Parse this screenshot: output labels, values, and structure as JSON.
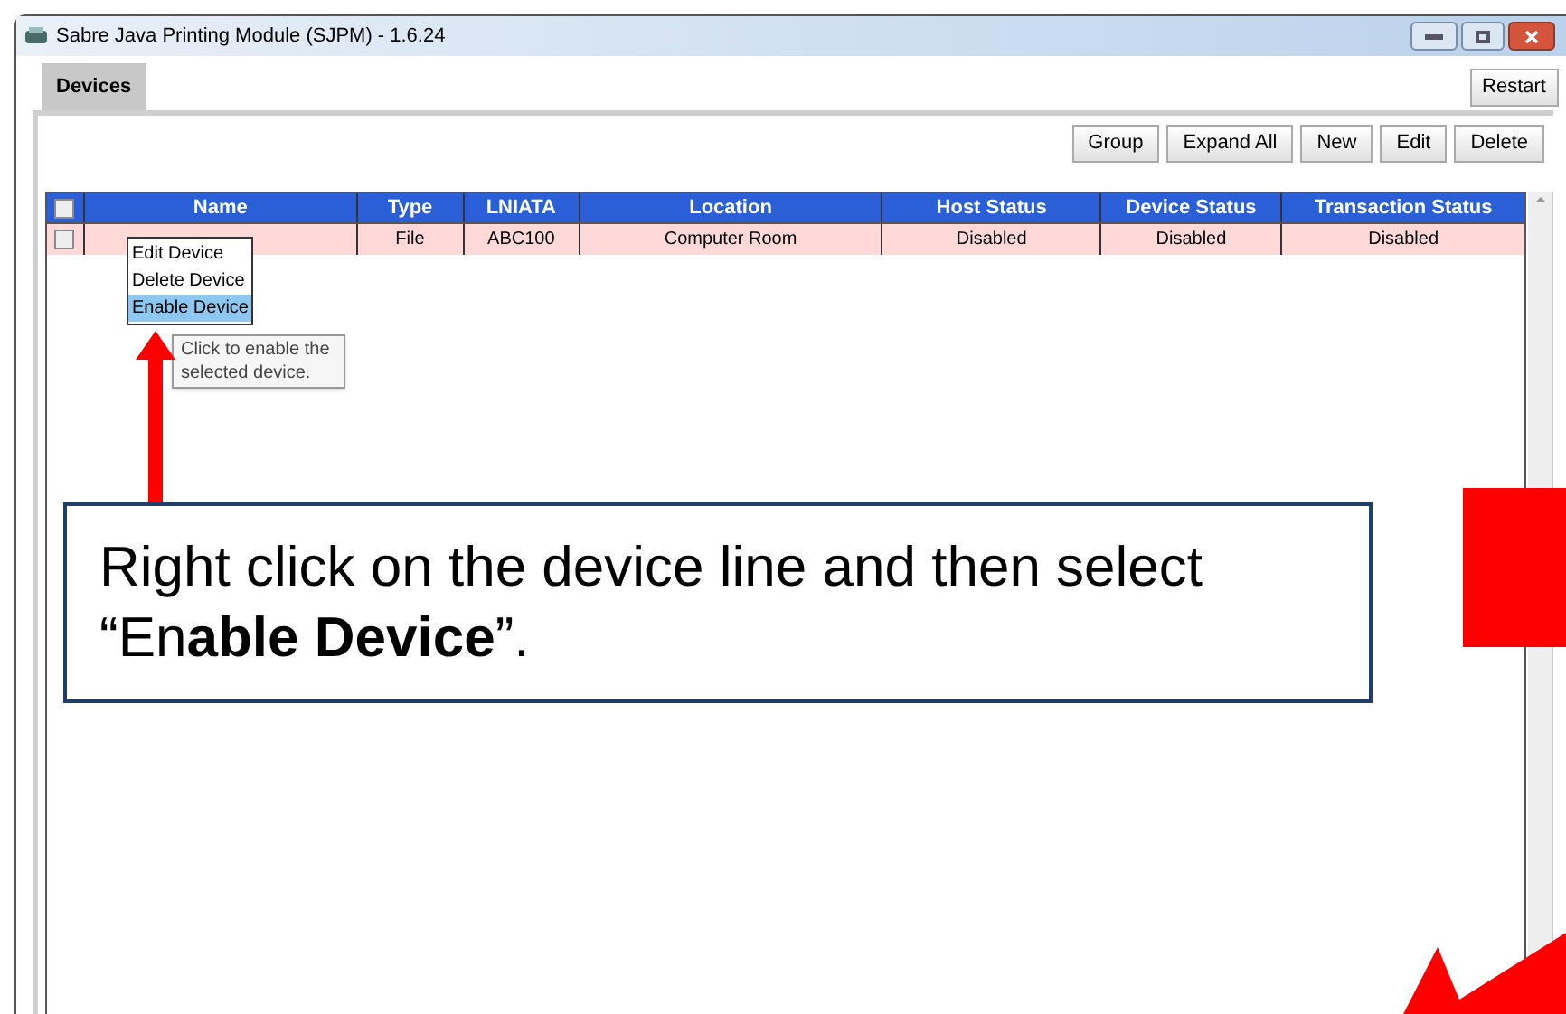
{
  "window": {
    "title": "Sabre Java Printing Module (SJPM) - 1.6.24"
  },
  "tabs": [
    {
      "label": "Devices",
      "selected": true
    }
  ],
  "restart_button": "Restart",
  "toolbar": [
    "Group",
    "Expand All",
    "New",
    "Edit",
    "Delete"
  ],
  "table": {
    "header_checked": false,
    "columns": [
      "Name",
      "Type",
      "LNIATA",
      "Location",
      "Host Status",
      "Device Status",
      "Transaction Status"
    ],
    "rows": [
      {
        "checked": false,
        "cells": [
          "",
          "File",
          "ABC100",
          "Computer Room",
          "Disabled",
          "Disabled",
          "Disabled"
        ]
      }
    ]
  },
  "context_menu": [
    {
      "label": "Edit Device",
      "selected": false
    },
    {
      "label": "Delete Device",
      "selected": false
    },
    {
      "label": "Enable Device",
      "selected": true
    }
  ],
  "tooltip": "Click to enable the selected device.",
  "callout": "Right click on the device line and then select “En**able Device**”."
}
